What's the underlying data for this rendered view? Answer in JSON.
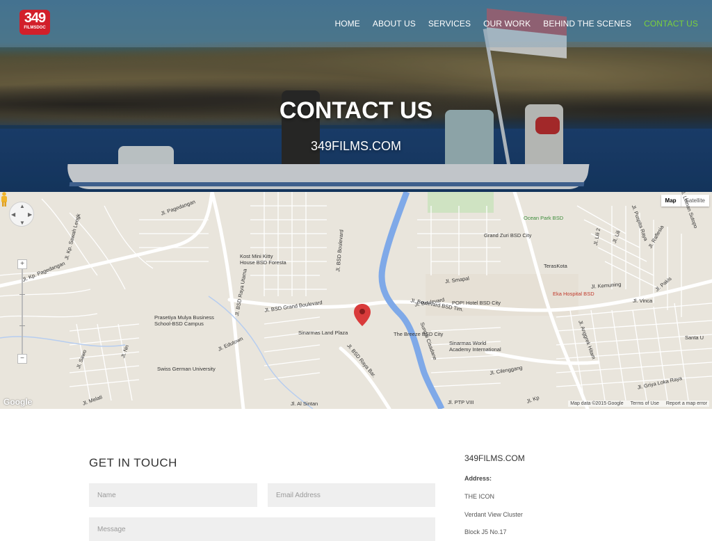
{
  "brand": {
    "logo_number": "349",
    "logo_sub": "FILMSDOC"
  },
  "nav": {
    "items": [
      {
        "label": "HOME"
      },
      {
        "label": "ABOUT US"
      },
      {
        "label": "SERVICES"
      },
      {
        "label": "OUR WORK"
      },
      {
        "label": "BEHIND THE SCENES"
      },
      {
        "label": "CONTACT US",
        "active": true
      }
    ],
    "active_color": "#7bd13c"
  },
  "hero": {
    "title": "CONTACT US",
    "subtitle": "349FILMS.COM"
  },
  "map": {
    "type_options": [
      "Map",
      "Satellite"
    ],
    "selected_type": "Map",
    "attribution": "Google",
    "footer": [
      "Map data ©2015 Google",
      "Terms of Use",
      "Report a map error"
    ],
    "zoom_in": "+",
    "zoom_out": "−",
    "labels": {
      "pagedangan": "Jl. Pagedangan",
      "sawah_lengkong": "Jl. Kp. Sawah Lengk",
      "kp_pagedangan": "Jl. Kp. Pagedangan",
      "bsd_raya_utama": "Jl. BSD Raya Utama",
      "bsd_boulevard": "Jl. BSD Boulevard",
      "kost": "Kost Mini Kitty\nHouse BSD Foresta",
      "grand_boulevard": "Jl. BSD Grand Boulevard",
      "prasetiya": "Prasetiya Mulya Business\nSchool-BSD Campus",
      "edutown": "Jl. Edutown",
      "sawo": "Jl. Sawo",
      "nn": "Jl. Nn",
      "swiss": "Swiss German University",
      "melati": "Jl. Melati",
      "sinarmas": "Sinarmas Land Plaza",
      "bsd_raya_barat": "Jl. BSD Raya Bar.",
      "al_sintan": "Jl. Al Sintan",
      "breeze": "The Breeze BSD City",
      "cisadane": "Sungai Cisadane",
      "sinarmas_world": "Sinarmas World\nAcademy International",
      "cilenggang": "Jl. Cilenggang",
      "ptp": "Jl. PTP VIII",
      "boulevard_tim": "Jl. Boulevard BSD Tim.",
      "pop": "POP! Hotel BSD City",
      "smapal": "Jl. Smapal",
      "ocean": "Ocean Park BSD",
      "grand_zuri": "Grand Zuri BSD City",
      "teraskota": "TerasKota",
      "eka": "Eka Hospital BSD",
      "kemuning": "Jl. Kemuning",
      "vinca": "Jl. Vinca",
      "anggrek": "Jl. Anggrek Hitam",
      "griya": "Jl. Griya Loka Raya",
      "santa": "Santa U",
      "lili": "Jl. Lili",
      "lili2": "Jl. Lili 2",
      "puspita": "Jl. Puspita Raya",
      "raflesia": "Jl. Raflesia",
      "letnan": "Jl. Letnan Sutopo",
      "pakis": "Jl. Pakis",
      "boulevard_bsd": "Jl. Boulevard",
      "kp": "Jl. Kp"
    }
  },
  "contact": {
    "heading": "GET IN TOUCH",
    "name_placeholder": "Name",
    "email_placeholder": "Email Address",
    "message_placeholder": "Message"
  },
  "sidebar": {
    "title": "349FILMS.COM",
    "address_label": "Address:",
    "address_lines": [
      "THE ICON",
      "Verdant View Cluster",
      "Block J5 No.17"
    ]
  }
}
